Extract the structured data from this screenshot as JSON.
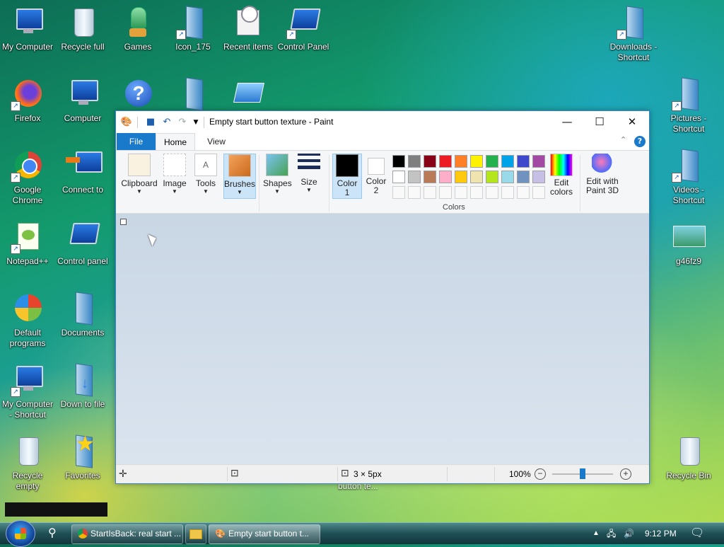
{
  "desktop": {
    "icons": [
      {
        "label": "My Computer",
        "icon": "computer-icon"
      },
      {
        "label": "Recycle full",
        "icon": "recycle-bin-full-icon"
      },
      {
        "label": "Games",
        "icon": "games-icon"
      },
      {
        "label": "Icon_175",
        "icon": "folder-icon"
      },
      {
        "label": "Recent items",
        "icon": "recent-items-icon"
      },
      {
        "label": "Control Panel",
        "icon": "control-panel-icon"
      },
      {
        "label": "Downloads - Shortcut",
        "icon": "downloads-folder-icon"
      },
      {
        "label": "Firefox",
        "icon": "firefox-icon"
      },
      {
        "label": "Computer",
        "icon": "computer-icon"
      },
      {
        "label": "Pictures - Shortcut",
        "icon": "pictures-folder-icon"
      },
      {
        "label": "Google Chrome",
        "icon": "chrome-icon"
      },
      {
        "label": "Connect to",
        "icon": "connect-to-icon"
      },
      {
        "label": "Videos - Shortcut",
        "icon": "videos-folder-icon"
      },
      {
        "label": "Notepad++",
        "icon": "notepad-plus-plus-icon"
      },
      {
        "label": "Control panel",
        "icon": "control-panel-icon"
      },
      {
        "label": "g46fz9",
        "icon": "image-file-icon"
      },
      {
        "label": "Default programs",
        "icon": "default-programs-icon"
      },
      {
        "label": "Documents",
        "icon": "documents-folder-icon"
      },
      {
        "label": "My Computer - Shortcut",
        "icon": "computer-icon"
      },
      {
        "label": "Down to file",
        "icon": "down-to-file-icon"
      },
      {
        "label": "Recycle empty",
        "icon": "recycle-bin-empty-icon"
      },
      {
        "label": "Favorites",
        "icon": "favorites-icon"
      },
      {
        "label": "Recycle Bin",
        "icon": "recycle-bin-icon"
      }
    ]
  },
  "paint": {
    "title": "Empty start button texture - Paint",
    "tabs": {
      "file": "File",
      "home": "Home",
      "view": "View"
    },
    "ribbon": {
      "clipboard": "Clipboard",
      "image": "Image",
      "tools": "Tools",
      "brushes": "Brushes",
      "shapes": "Shapes",
      "size": "Size",
      "color1": "Color 1",
      "color2": "Color 2",
      "colors_group": "Colors",
      "edit_colors": "Edit colors",
      "edit_paint3d": "Edit with Paint 3D"
    },
    "palette_row1": [
      "#000000",
      "#7f7f7f",
      "#880015",
      "#ed1c24",
      "#ff7f27",
      "#fff200",
      "#22b14c",
      "#00a2e8",
      "#3f48cc",
      "#a349a4"
    ],
    "palette_row2": [
      "#ffffff",
      "#c3c3c3",
      "#b97a57",
      "#ffaec9",
      "#ffc90e",
      "#efe4b0",
      "#b5e61d",
      "#99d9ea",
      "#7092be",
      "#c8bfe7"
    ],
    "color1_value": "#000000",
    "color2_value": "#ffffff",
    "status": {
      "dimensions": "3 × 5px",
      "zoom": "100%"
    },
    "tooltip_partial": "button te..."
  },
  "taskbar": {
    "chrome_task": "StartIsBack: real start ...",
    "paint_task": "Empty start button t...",
    "time": "9:12 PM"
  },
  "accent": "#1979ca"
}
